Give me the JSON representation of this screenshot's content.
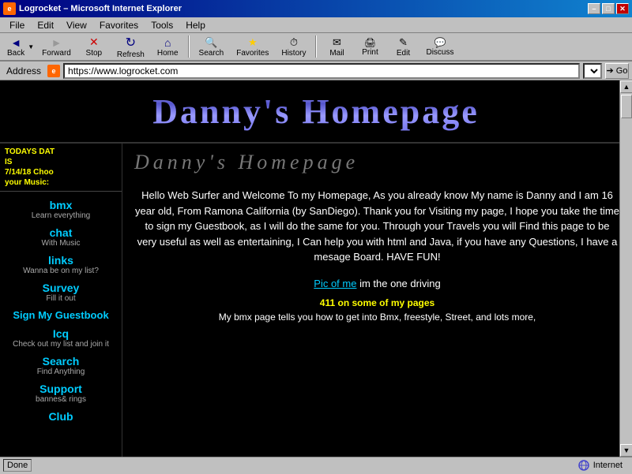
{
  "window": {
    "title": "Logrocket – Microsoft Internet Explorer",
    "icon": "IE"
  },
  "titlebar_buttons": {
    "minimize": "–",
    "maximize": "□",
    "close": "✕"
  },
  "menu": {
    "items": [
      "File",
      "Edit",
      "View",
      "Favorites",
      "Tools",
      "Help"
    ]
  },
  "toolbar": {
    "back_label": "Back",
    "forward_label": "Forward",
    "stop_label": "Stop",
    "refresh_label": "Refresh",
    "home_label": "Home",
    "search_label": "Search",
    "favorites_label": "Favorites",
    "history_label": "History",
    "mail_label": "Mail",
    "print_label": "Print",
    "edit_label": "Edit",
    "discuss_label": "Discuss"
  },
  "address_bar": {
    "label": "Address",
    "url": "https://www.logrocket.com",
    "go_label": "Go"
  },
  "sidebar": {
    "ad_line1": "TODAYS DAT",
    "ad_line2": "IS",
    "ad_line3": "7/14/18 Choo",
    "ad_line4": "your Music:",
    "nav_items": [
      {
        "main": "bmx",
        "sub": "Learn everything"
      },
      {
        "main": "chat",
        "sub": "With Music"
      },
      {
        "main": "links",
        "sub": "Wanna be on my list?"
      },
      {
        "main": "Survey",
        "sub": "Fill it out"
      },
      {
        "main": "Sign My Guestbook",
        "sub": ""
      },
      {
        "main": "Icq",
        "sub": "Check out my list and join it"
      },
      {
        "main": "Search",
        "sub": "Find Anything"
      },
      {
        "main": "Support",
        "sub": "bannes& rings"
      },
      {
        "main": "Club",
        "sub": ""
      }
    ]
  },
  "page": {
    "banner_title": "Danny's Homepage",
    "subtitle_styled": "Danny's Homepage",
    "welcome_text": "Hello Web Surfer and Welcome To my Homepage, As you already know My name is Danny and I am 16 year old, From Ramona California (by SanDiego). Thank you for Visiting my page, I hope you take the time to sign my Guestbook, as I will do the same for you. Through your Travels you will Find this page to be very useful as well as entertaining, I Can help you with html and Java, if you have any Questions, I have a mesage Board. HAVE FUN!",
    "pic_link_text": "Pic of me",
    "pic_suffix": " im the one driving",
    "yellow_text": "411 on some of my pages",
    "bottom_text": "My bmx page tells you how to get into Bmx, freestyle, Street, and lots more,"
  },
  "status_bar": {
    "left": "Done",
    "right": "Internet"
  }
}
